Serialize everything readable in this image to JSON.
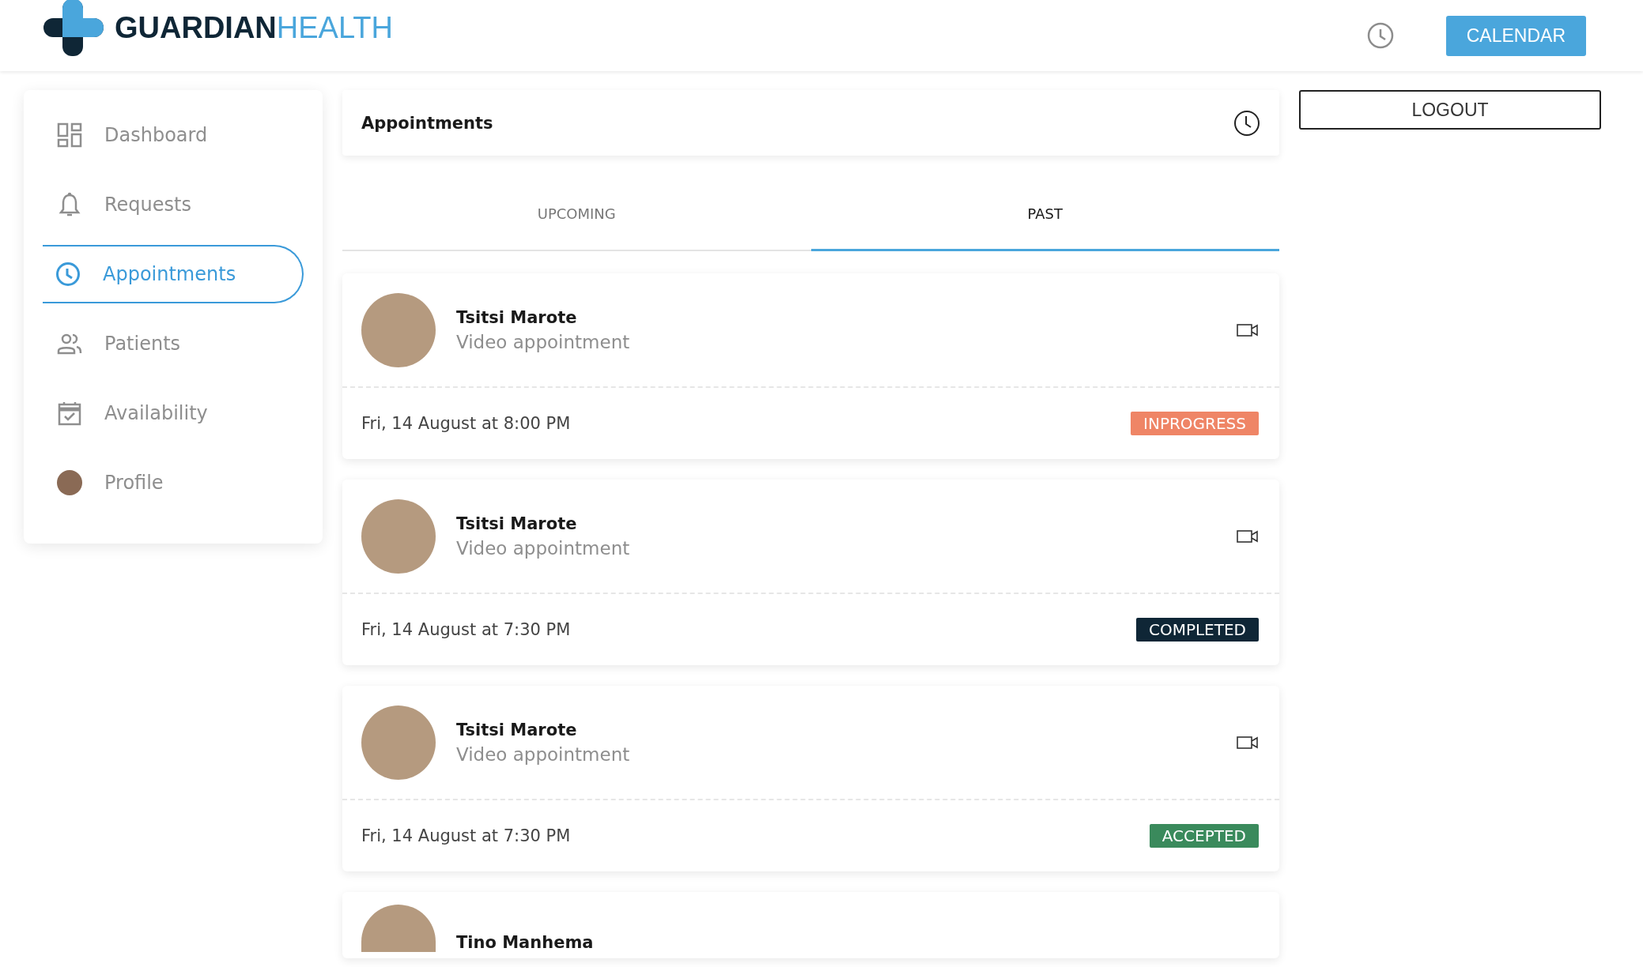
{
  "header": {
    "logo_bold": "GUARDIAN",
    "logo_light": "HEALTH",
    "calendar_button": "CALENDAR"
  },
  "sidebar": {
    "items": [
      {
        "label": "Dashboard",
        "kind": "dashboard",
        "selected": false
      },
      {
        "label": "Requests",
        "kind": "bell",
        "selected": false
      },
      {
        "label": "Appointments",
        "kind": "clock",
        "selected": true
      },
      {
        "label": "Patients",
        "kind": "people",
        "selected": false
      },
      {
        "label": "Availability",
        "kind": "calendar",
        "selected": false
      },
      {
        "label": "Profile",
        "kind": "avatar",
        "selected": false
      }
    ]
  },
  "panel": {
    "title": "Appointments"
  },
  "tabs": [
    {
      "label": "UPCOMING",
      "selected": false
    },
    {
      "label": "PAST",
      "selected": true
    }
  ],
  "appointments": [
    {
      "name": "Tsitsi Marote",
      "type": "Video appointment",
      "time": "Fri, 14 August at 8:00 PM",
      "status": "INPROGRESS",
      "color": "#ef8566"
    },
    {
      "name": "Tsitsi Marote",
      "type": "Video appointment",
      "time": "Fri, 14 August at 7:30 PM",
      "status": "COMPLETED",
      "color": "#0f2636"
    },
    {
      "name": "Tsitsi Marote",
      "type": "Video appointment",
      "time": "Fri, 14 August at 7:30 PM",
      "status": "ACCEPTED",
      "color": "#3a8a5c"
    },
    {
      "name": "Tino Manhema"
    }
  ],
  "logout_button": "LOGOUT"
}
